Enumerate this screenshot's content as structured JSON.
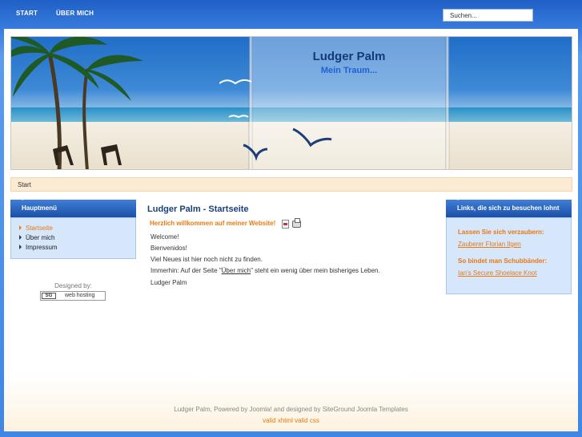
{
  "nav": {
    "items": [
      {
        "label": "START"
      },
      {
        "label": "ÜBER MICH"
      }
    ],
    "search": {
      "value": "Suchen..."
    }
  },
  "header": {
    "site_title": "Ludger Palm",
    "slogan": "Mein Traum..."
  },
  "breadcrumb": "Start",
  "left_module": {
    "title": "Hauptmenü",
    "items": [
      {
        "label": "Startseite",
        "active": true
      },
      {
        "label": "Über mich",
        "active": false
      },
      {
        "label": "Impressum",
        "active": false
      }
    ],
    "designed_by": "Designed by:",
    "badge_logo": "SG",
    "badge_text": "web hosting"
  },
  "content": {
    "title": "Ludger Palm - Startseite",
    "intro": "Herzlich willkommen auf meiner Website!",
    "lines": {
      "l1": "Welcome!",
      "l2": "Bienvenidos!",
      "l3": "Viel Neues ist hier noch nicht zu finden.",
      "l4_pre": "Immerhin: Auf der Seite \"",
      "l4_link": "Über mich",
      "l4_post": "\" steht ein wenig über mein bisheriges Leben.",
      "l5": "Ludger Palm"
    }
  },
  "right_module": {
    "title": "Links, die sich zu besuchen lohnt",
    "heading1": "Lassen Sie sich verzaubern:",
    "link1": "Zauberer Florian Ilgen",
    "heading2": "So bindet man Schubbänder:",
    "link2": "Ian's Secure Shoelace Knot"
  },
  "footer": {
    "text": "Ludger Palm, Powered by Joomla! and designed by SiteGround Joomla Templates",
    "links": "valid xhtml valid css"
  },
  "colors": {
    "accent": "#e8790f",
    "nav_blue": "#1f5fc6",
    "title_blue": "#1a3f7a"
  }
}
